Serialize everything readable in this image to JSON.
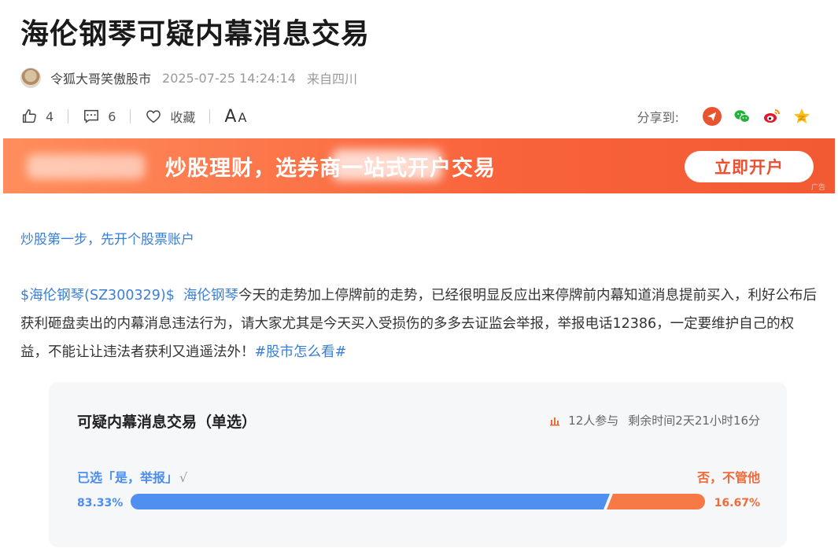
{
  "article": {
    "title": "海伦钢琴可疑内幕消息交易",
    "author": "令狐大哥笑傲股市",
    "datetime": "2025-07-25 14:24:14",
    "location": "来自四川"
  },
  "actions": {
    "like_count": "4",
    "comment_count": "6",
    "favorite_label": "收藏",
    "font_big": "A",
    "font_small": "A",
    "share_label": "分享到:"
  },
  "banner": {
    "text": "炒股理财，选券商一站式开户交易",
    "button_label": "立即开户",
    "ad_tag": "广告"
  },
  "promo_link": "炒股第一步，先开个股票账户",
  "body": {
    "stock_tag": "$海伦钢琴(SZ300329)$",
    "stock_name": "海伦钢琴",
    "text": "今天的走势加上停牌前的走势，已经很明显反应出来停牌前内幕知道消息提前买入，利好公布后获利砸盘卖出的内幕消息违法行为，请大家尤其是今天买入受损伤的多多去证监会举报，举报电话12386，一定要维护自己的权益，不能让让违法者获利又逍遥法外！",
    "topic": "#股市怎么看#"
  },
  "poll": {
    "title": "可疑内幕消息交易（单选）",
    "participants": "12人参与",
    "remaining": "剩余时间2天21小时16分",
    "selected_prefix": "已选「",
    "option_a": "是，举报",
    "selected_suffix": "」",
    "check": "√",
    "option_b": "否，不管他",
    "pct_a_label": "83.33%",
    "pct_b_label": "16.67%",
    "pct_a": 83.33,
    "pct_b": 16.67
  },
  "colors": {
    "link": "#3a7ed6",
    "poll_blue": "#4f8ff0",
    "poll_orange": "#f77a46",
    "banner": "#f9633b"
  }
}
